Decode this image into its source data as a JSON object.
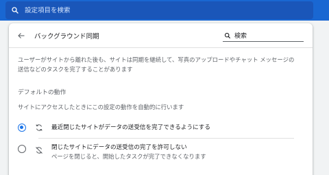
{
  "search": {
    "placeholder": "設定項目を検索"
  },
  "page": {
    "title": "バックグラウンド同期",
    "search_value": "検索"
  },
  "description_line1": "ユーザーがサイトから離れた後も、サイトは同期を継続して、写真のアップロードやチャット メッセージの",
  "description_line2": "送信などのタスクを完了することがあります",
  "default_behavior": {
    "title": "デフォルトの動作",
    "description": "サイトにアクセスしたときにこの設定の動作を自動的に行います"
  },
  "options": [
    {
      "label": "最近閉じたサイトがデータの送受信を完了できるようにする",
      "selected": true
    },
    {
      "label": "閉じたサイトにデータの送受信の完了を許可しない",
      "sublabel": "ページを閉じると、開始したタスクが完了できなくなります",
      "selected": false
    }
  ],
  "colors": {
    "topbar": "#1967d2",
    "accent": "#1a73e8"
  }
}
